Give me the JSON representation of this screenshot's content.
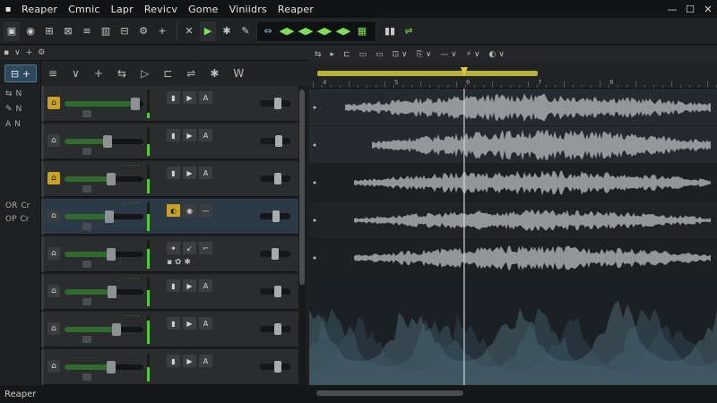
{
  "app": {
    "logo_glyph": "▪"
  },
  "menu": [
    "Reaper",
    "Cmnic",
    "Lapr",
    "Revicv",
    "Gome",
    "Viniidrs",
    "Reaper"
  ],
  "window_controls": {
    "minimize": "—",
    "maximize": "☐",
    "close": "✕"
  },
  "toolbar": {
    "left_icons": [
      "file-icon",
      "record-icon",
      "mixer-icon",
      "grid-icon",
      "list-icon",
      "bars-icon",
      "layout-icon",
      "fx-icon",
      "plus-icon"
    ],
    "left_glyphs": [
      "▣",
      "◉",
      "⊞",
      "⊠",
      "≡",
      "▥",
      "⊟",
      "⚙",
      "+"
    ],
    "mid_glyphs": [
      "✕",
      "▶",
      "✱",
      "✎"
    ],
    "transport_group_glyphs": [
      "⇔",
      "◀▶",
      "◀▶",
      "◀▶",
      "◀▶",
      "▦"
    ],
    "right_glyphs": [
      "▮▮",
      "⇌"
    ],
    "accent_green": "#7fe05a"
  },
  "tcp_header": {
    "items": [
      "▪",
      "∨",
      "+",
      "⚙"
    ]
  },
  "tcp_tools": [
    "≡",
    "∨",
    "+",
    "⇆",
    "▷",
    "⊏",
    "⇌",
    "✱",
    "W"
  ],
  "new_track_label": "⊟ +",
  "sidecol": [
    {
      "a": "⇆",
      "b": "N"
    },
    {
      "a": "✎",
      "b": "N"
    },
    {
      "a": "A",
      "b": "N"
    },
    {
      "a": "OR",
      "b": "Cr"
    },
    {
      "a": "OP",
      "b": "Cr"
    }
  ],
  "tracks": [
    {
      "icon": "⌂",
      "yellow": true,
      "level": 0.95,
      "knob": 0.95,
      "pan": 0.6,
      "vu": 0.2,
      "buttons": [
        "▮",
        "▶",
        "A"
      ],
      "label": "",
      "selected": false
    },
    {
      "icon": "⌂",
      "yellow": false,
      "level": 0.55,
      "knob": 0.55,
      "pan": 0.65,
      "vu": 0.4,
      "buttons": [
        "▮",
        "▶",
        "A"
      ],
      "label": "",
      "selected": false
    },
    {
      "icon": "⌂",
      "yellow": true,
      "level": 0.6,
      "knob": 0.6,
      "pan": 0.6,
      "vu": 0.5,
      "buttons": [
        "▮",
        "▶",
        "A"
      ],
      "label": "· · · · ·",
      "selected": false
    },
    {
      "icon": "⌂",
      "yellow": false,
      "level": 0.58,
      "knob": 0.58,
      "pan": 0.55,
      "vu": 0.6,
      "buttons": [
        "◐",
        "◉",
        "—"
      ],
      "label": "· · · · ·",
      "selected": true,
      "active_first": true
    },
    {
      "icon": "⌂",
      "yellow": false,
      "level": 0.6,
      "knob": 0.6,
      "pan": 0.5,
      "vu": 0.7,
      "buttons": [
        "✦",
        "↙",
        "⌐"
      ],
      "label": "",
      "selected": false,
      "fx": "▪  ✿  ✱"
    },
    {
      "icon": "⌂",
      "yellow": false,
      "level": 0.62,
      "knob": 0.62,
      "pan": 0.6,
      "vu": 0.55,
      "buttons": [
        "▮",
        "▶",
        "A"
      ],
      "label": "· · · · ·",
      "selected": false
    },
    {
      "icon": "⌂",
      "yellow": false,
      "level": 0.68,
      "knob": 0.68,
      "pan": 0.6,
      "vu": 0.8,
      "buttons": [
        "▮",
        "▶",
        "A"
      ],
      "label": "· · · · ·",
      "selected": false
    },
    {
      "icon": "⌂",
      "yellow": false,
      "level": 0.6,
      "knob": 0.6,
      "pan": 0.6,
      "vu": 0.5,
      "buttons": [
        "▮",
        "▶",
        "A"
      ],
      "label": "",
      "selected": false
    },
    {
      "icon": "⌂",
      "yellow": false,
      "level": 0.62,
      "knob": 0.62,
      "pan": 0.6,
      "vu": 0.45,
      "buttons": [
        "▮",
        "▶",
        "A"
      ],
      "label": "· · · · ·",
      "selected": false
    }
  ],
  "arrange_tools": [
    "⇆",
    "▸",
    "⊏",
    "▭",
    "▭",
    "⊡ ∨",
    "⎘ ∨",
    "— ∨",
    "⚡ ∨",
    "◐ ∨"
  ],
  "ruler": {
    "ticks": [
      "4",
      "5",
      "6",
      "7",
      "8"
    ],
    "loop_start": 0.02,
    "loop_end": 0.56,
    "playhead": 0.38
  },
  "statusbar": {
    "label": "Reaper"
  }
}
